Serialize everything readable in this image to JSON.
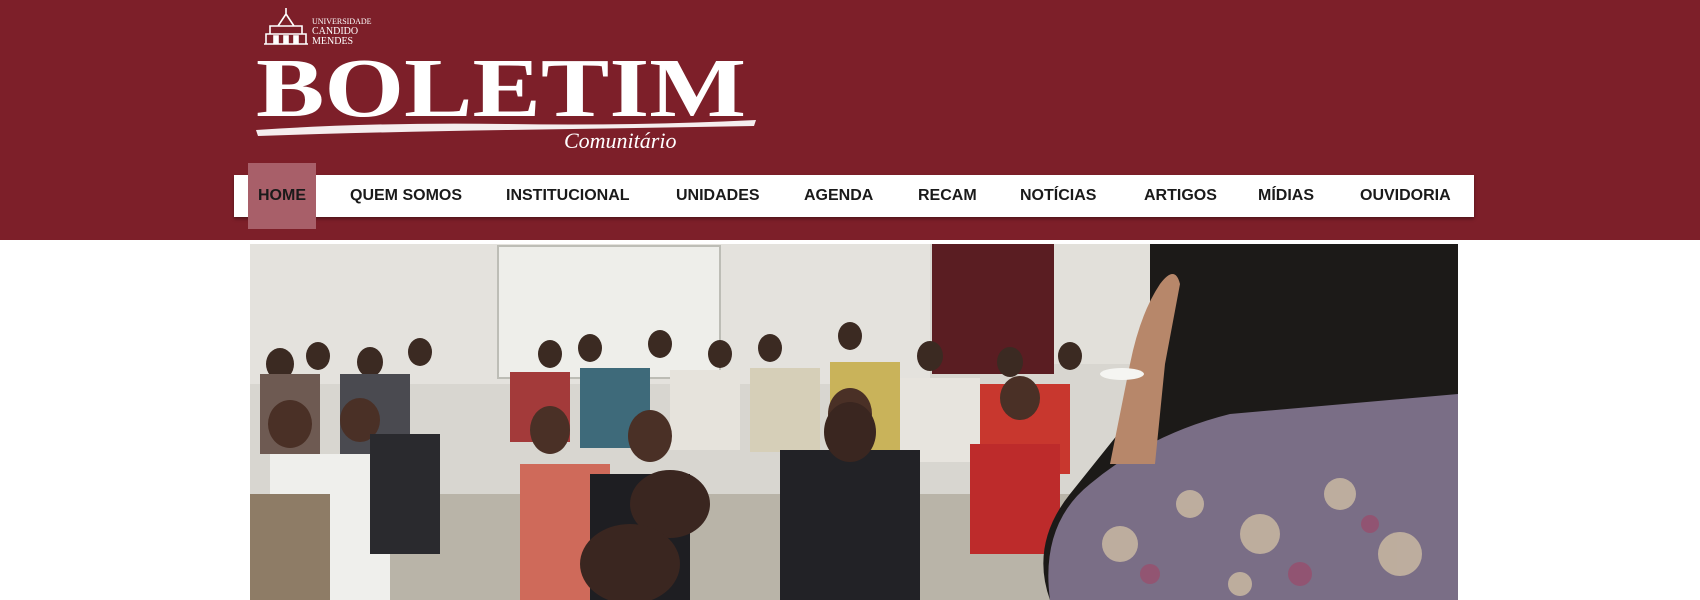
{
  "brand": {
    "university_line1": "UNIVERSIDADE",
    "university_line2": "CANDIDO",
    "university_line3": "MENDES",
    "title": "BOLETIM",
    "subtitle": "Comunitário"
  },
  "colors": {
    "header_bg": "#7d1f29",
    "nav_bg": "#ffffff",
    "nav_active_bg": "#a85f69",
    "nav_text": "#1a1a1a"
  },
  "nav": {
    "items": [
      {
        "label": "HOME",
        "active": true
      },
      {
        "label": "QUEM SOMOS"
      },
      {
        "label": "INSTITUCIONAL"
      },
      {
        "label": "UNIDADES"
      },
      {
        "label": "AGENDA"
      },
      {
        "label": "RECAM"
      },
      {
        "label": "NOTÍCIAS"
      },
      {
        "label": "ARTIGOS"
      },
      {
        "label": "MÍDIAS"
      },
      {
        "label": "OUVIDORIA"
      }
    ]
  },
  "hero": {
    "icon": "classroom-photo"
  }
}
